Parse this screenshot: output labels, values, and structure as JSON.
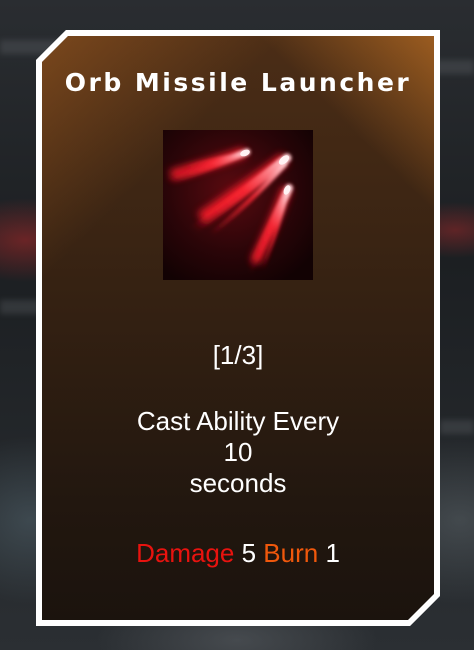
{
  "card": {
    "title": "Orb Missile Launcher",
    "icon": "orb-missile-icon",
    "level": "[1/3]",
    "description": {
      "line1": "Cast Ability Every",
      "line2": "10",
      "line3": "seconds"
    },
    "stats": [
      {
        "label": "Damage",
        "value": "5",
        "color": "#e8130f"
      },
      {
        "label": "Burn",
        "value": "1",
        "color": "#f0580c"
      }
    ]
  },
  "colors": {
    "card_frame": "#ffffff",
    "card_top": "#4b2d16",
    "card_bottom": "#1b130d",
    "accent_orange": "#d9802a"
  }
}
